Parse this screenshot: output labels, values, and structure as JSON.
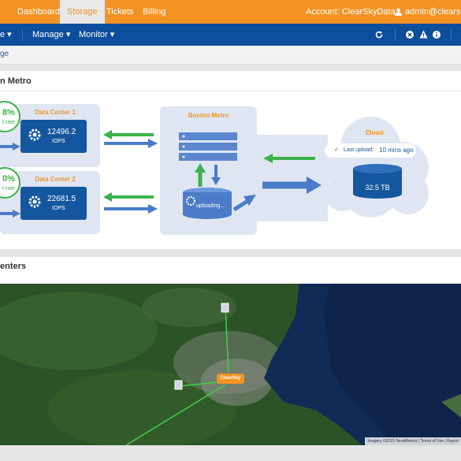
{
  "topnav": {
    "tabs": [
      "Dashboard",
      "Storage",
      "Tickets",
      "Billing"
    ],
    "account": "Account: ClearSkyData",
    "user": "admin@clearskyd"
  },
  "subnav": {
    "first_fragment": "e",
    "manage": "Manage",
    "monitor": "Monitor"
  },
  "breadcrumb": "ge",
  "metro_panel": {
    "title": "n Metro",
    "dc1": {
      "title": "Data Center 1",
      "iops": "12496.2",
      "unit": "IOPS",
      "pct": "8%",
      "rate": "t rate"
    },
    "dc2": {
      "title": "Data Center 2",
      "iops": "22681.5",
      "unit": "IOPS",
      "pct": "0%",
      "rate": "t rate"
    },
    "metro": {
      "title": "Boston Metro",
      "status": "uploading..."
    },
    "cloud": {
      "title": "Cloud",
      "last_upload": "Last upload:",
      "last_upload_time": "10 mins ago",
      "capacity": "32.5 TB"
    }
  },
  "centers_panel": {
    "title": "enters",
    "map_marker": "ClearSky",
    "attribution": "Imagery ©2015 TerraMetrics | Terms of Use | Report"
  },
  "colors": {
    "orange": "#f39324",
    "navy": "#0d4f9c",
    "green": "#3bb24a",
    "blue_arrow": "#4a7cc9"
  }
}
